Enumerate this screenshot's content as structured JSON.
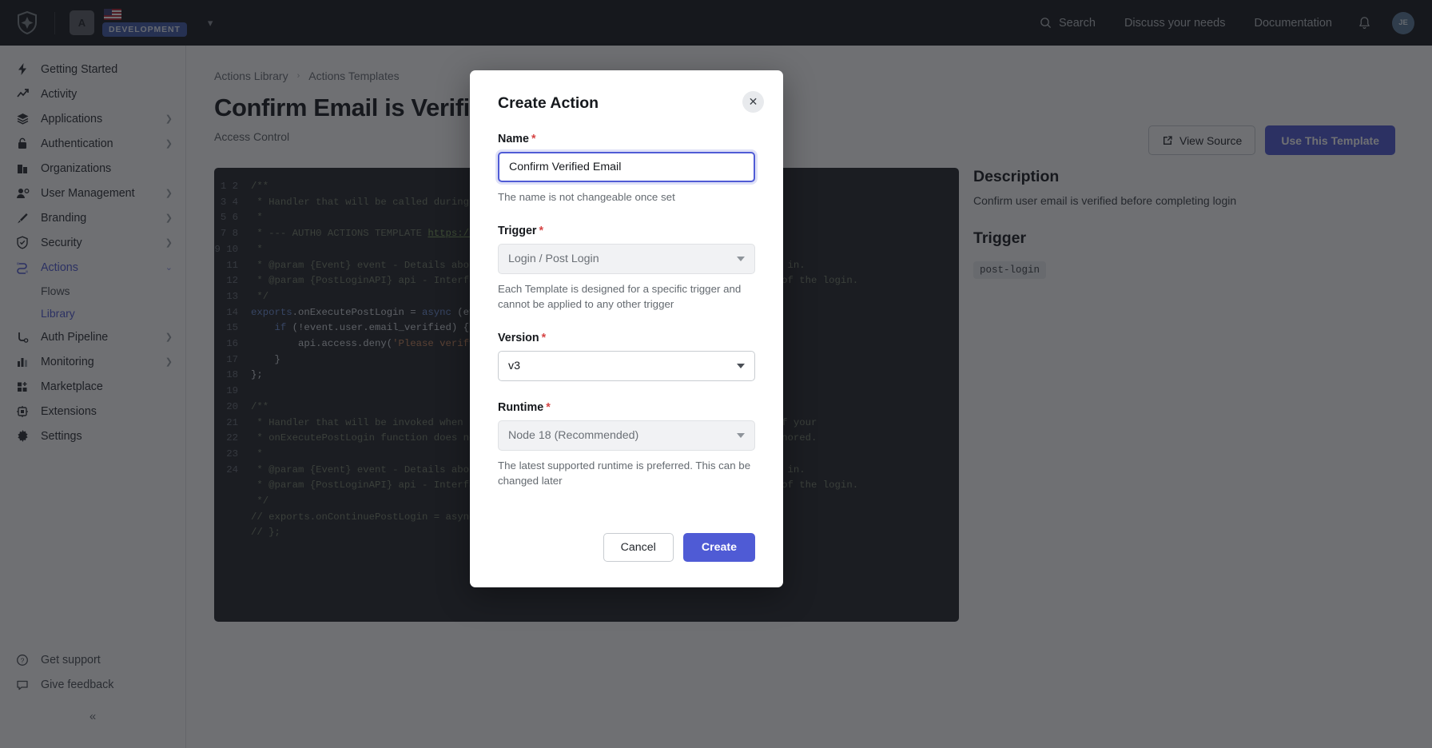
{
  "topbar": {
    "logo_icon": "auth0-shield-icon",
    "tenant_initial": "A",
    "region_flag": "us-flag-icon",
    "env_badge": "DEVELOPMENT",
    "tenant_chevron_icon": "chevron-down-icon",
    "search_label": "Search",
    "search_icon": "search-icon",
    "discuss_label": "Discuss your needs",
    "documentation_label": "Documentation",
    "notifications_icon": "bell-icon",
    "avatar_initials": "JE"
  },
  "sidebar": {
    "items": [
      {
        "label": "Getting Started",
        "icon": "bolt-icon",
        "chevron": false,
        "active": false
      },
      {
        "label": "Activity",
        "icon": "trend-up-icon",
        "chevron": false,
        "active": false
      },
      {
        "label": "Applications",
        "icon": "layers-icon",
        "chevron": true,
        "active": false
      },
      {
        "label": "Authentication",
        "icon": "lock-icon",
        "chevron": true,
        "active": false
      },
      {
        "label": "Organizations",
        "icon": "building-icon",
        "chevron": false,
        "active": false
      },
      {
        "label": "User Management",
        "icon": "user-gear-icon",
        "chevron": true,
        "active": false
      },
      {
        "label": "Branding",
        "icon": "brush-icon",
        "chevron": true,
        "active": false
      },
      {
        "label": "Security",
        "icon": "shield-check-icon",
        "chevron": true,
        "active": false
      },
      {
        "label": "Actions",
        "icon": "actions-icon",
        "chevron": true,
        "active": true
      }
    ],
    "sub_items": [
      {
        "label": "Flows",
        "active": false
      },
      {
        "label": "Library",
        "active": true
      }
    ],
    "items_after": [
      {
        "label": "Auth Pipeline",
        "icon": "pipeline-icon",
        "chevron": true
      },
      {
        "label": "Monitoring",
        "icon": "bar-chart-icon",
        "chevron": true
      },
      {
        "label": "Marketplace",
        "icon": "marketplace-icon",
        "chevron": false
      },
      {
        "label": "Extensions",
        "icon": "puzzle-icon",
        "chevron": false
      },
      {
        "label": "Settings",
        "icon": "gear-icon",
        "chevron": false
      }
    ],
    "footer": [
      {
        "label": "Get support",
        "icon": "question-circle-icon"
      },
      {
        "label": "Give feedback",
        "icon": "chat-icon"
      }
    ],
    "collapse_icon": "chevron-double-left-icon"
  },
  "page": {
    "breadcrumb": [
      "Actions Library",
      "Actions Templates"
    ],
    "breadcrumb_separator": "›",
    "title": "Confirm Email is Verified",
    "subtitle": "Access Control",
    "view_source_label": "View Source",
    "view_source_icon": "external-link-icon",
    "use_template_label": "Use This Template"
  },
  "code": {
    "line_numbers": [
      "1",
      "2",
      "3",
      "4",
      "5",
      "6",
      "7",
      "8",
      "9",
      "10",
      "11",
      "12",
      "13",
      "14",
      "15",
      "16",
      "17",
      "18",
      "19",
      "20",
      "21",
      "22",
      "23",
      "24"
    ],
    "lines": [
      "/**",
      " * Handler that will be called during the execution of a PostLogin flow.",
      " *",
      " * --- AUTH0 ACTIONS TEMPLATE https://git.io/confirm-email-verified-POST_LOGIN ---",
      " *",
      " * @param {Event} event - Details about the user and the context in which they are logging in.",
      " * @param {PostLoginAPI} api - Interface whose methods can be used to change the behavior of the login.",
      " */",
      "exports.onExecutePostLogin = async (event, api) => {",
      "    if (!event.user.email_verified) {",
      "        api.access.deny('Please verify your email before logging in.');",
      "    }",
      "};",
      "",
      "/**",
      " * Handler that will be invoked when this action is resuming after an external redirect. If your",
      " * onExecutePostLogin function does not perform a redirect, this function can be safely ignored.",
      " *",
      " * @param {Event} event - Details about the user and the context in which they are logging in.",
      " * @param {PostLoginAPI} api - Interface whose methods can be used to change the behavior of the login.",
      " */",
      "// exports.onContinuePostLogin = async (event, api) => {",
      "// };",
      ""
    ]
  },
  "info_panel": {
    "description_heading": "Description",
    "description_text": "Confirm user email is verified before completing login",
    "trigger_heading": "Trigger",
    "trigger_value": "post-login"
  },
  "modal": {
    "title": "Create Action",
    "close_icon": "close-icon",
    "name": {
      "label": "Name",
      "required_mark": "*",
      "value": "Confirm Verified Email",
      "placeholder": "",
      "help": "The name is not changeable once set"
    },
    "trigger": {
      "label": "Trigger",
      "required_mark": "*",
      "value": "Login / Post Login",
      "help": "Each Template is designed for a specific trigger and cannot be applied to any other trigger",
      "caret_icon": "chevron-down-icon",
      "disabled": true
    },
    "version": {
      "label": "Version",
      "required_mark": "*",
      "value": "v3",
      "caret_icon": "chevron-down-icon",
      "disabled": false
    },
    "runtime": {
      "label": "Runtime",
      "required_mark": "*",
      "value": "Node 18 (Recommended)",
      "help": "The latest supported runtime is preferred. This can be changed later",
      "caret_icon": "chevron-down-icon",
      "disabled": true
    },
    "cancel_label": "Cancel",
    "create_label": "Create"
  },
  "colors": {
    "accent": "#4f5bd5",
    "topbar_bg": "#16191d",
    "code_bg": "#22262b",
    "required_red": "#d64545",
    "env_badge_bg": "#3f59a9"
  }
}
